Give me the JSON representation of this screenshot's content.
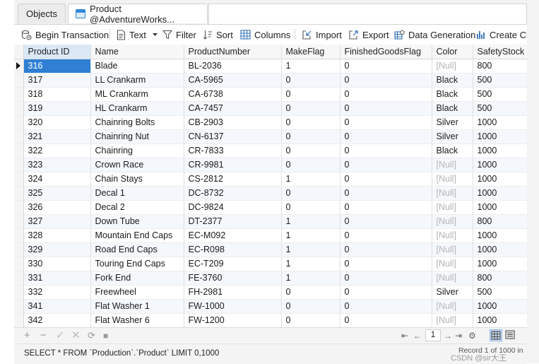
{
  "tabs": [
    {
      "label": "Objects"
    },
    {
      "label": "Product @AdventureWorks..."
    }
  ],
  "toolbar": {
    "begin_transaction": "Begin Transaction",
    "text": "Text",
    "filter": "Filter",
    "sort": "Sort",
    "columns": "Columns",
    "import": "Import",
    "export": "Export",
    "data_generation": "Data Generation",
    "create_chart": "Create Cha"
  },
  "grid": {
    "columns": [
      "Product ID",
      "Name",
      "ProductNumber",
      "MakeFlag",
      "FinishedGoodsFlag",
      "Color",
      "SafetyStock"
    ],
    "rows": [
      [
        "316",
        "Blade",
        "BL-2036",
        "1",
        "0",
        "[Null]",
        "800"
      ],
      [
        "317",
        "LL Crankarm",
        "CA-5965",
        "0",
        "0",
        "Black",
        "500"
      ],
      [
        "318",
        "ML Crankarm",
        "CA-6738",
        "0",
        "0",
        "Black",
        "500"
      ],
      [
        "319",
        "HL Crankarm",
        "CA-7457",
        "0",
        "0",
        "Black",
        "500"
      ],
      [
        "320",
        "Chainring Bolts",
        "CB-2903",
        "0",
        "0",
        "Silver",
        "1000"
      ],
      [
        "321",
        "Chainring Nut",
        "CN-6137",
        "0",
        "0",
        "Silver",
        "1000"
      ],
      [
        "322",
        "Chainring",
        "CR-7833",
        "0",
        "0",
        "Black",
        "1000"
      ],
      [
        "323",
        "Crown Race",
        "CR-9981",
        "0",
        "0",
        "[Null]",
        "1000"
      ],
      [
        "324",
        "Chain Stays",
        "CS-2812",
        "1",
        "0",
        "[Null]",
        "1000"
      ],
      [
        "325",
        "Decal 1",
        "DC-8732",
        "0",
        "0",
        "[Null]",
        "1000"
      ],
      [
        "326",
        "Decal 2",
        "DC-9824",
        "0",
        "0",
        "[Null]",
        "1000"
      ],
      [
        "327",
        "Down Tube",
        "DT-2377",
        "1",
        "0",
        "[Null]",
        "800"
      ],
      [
        "328",
        "Mountain End Caps",
        "EC-M092",
        "1",
        "0",
        "[Null]",
        "1000"
      ],
      [
        "329",
        "Road End Caps",
        "EC-R098",
        "1",
        "0",
        "[Null]",
        "1000"
      ],
      [
        "330",
        "Touring End Caps",
        "EC-T209",
        "1",
        "0",
        "[Null]",
        "1000"
      ],
      [
        "331",
        "Fork End",
        "FE-3760",
        "1",
        "0",
        "[Null]",
        "800"
      ],
      [
        "332",
        "Freewheel",
        "FH-2981",
        "0",
        "0",
        "Silver",
        "500"
      ],
      [
        "341",
        "Flat Washer 1",
        "FW-1000",
        "0",
        "0",
        "[Null]",
        "1000"
      ],
      [
        "342",
        "Flat Washer 6",
        "FW-1200",
        "0",
        "0",
        "[Null]",
        "1000"
      ]
    ]
  },
  "pager": {
    "page": "1"
  },
  "status": {
    "sql": "SELECT * FROM `Production`.`Product` LIMIT 0,1000",
    "record": "Record 1 of 1000 in",
    "watermark": "CSDN @sir大王"
  },
  "colors": {
    "accent": "#2f7fd3",
    "null_text": "#b5b5b5",
    "alt_row": "#f4f8fd"
  }
}
